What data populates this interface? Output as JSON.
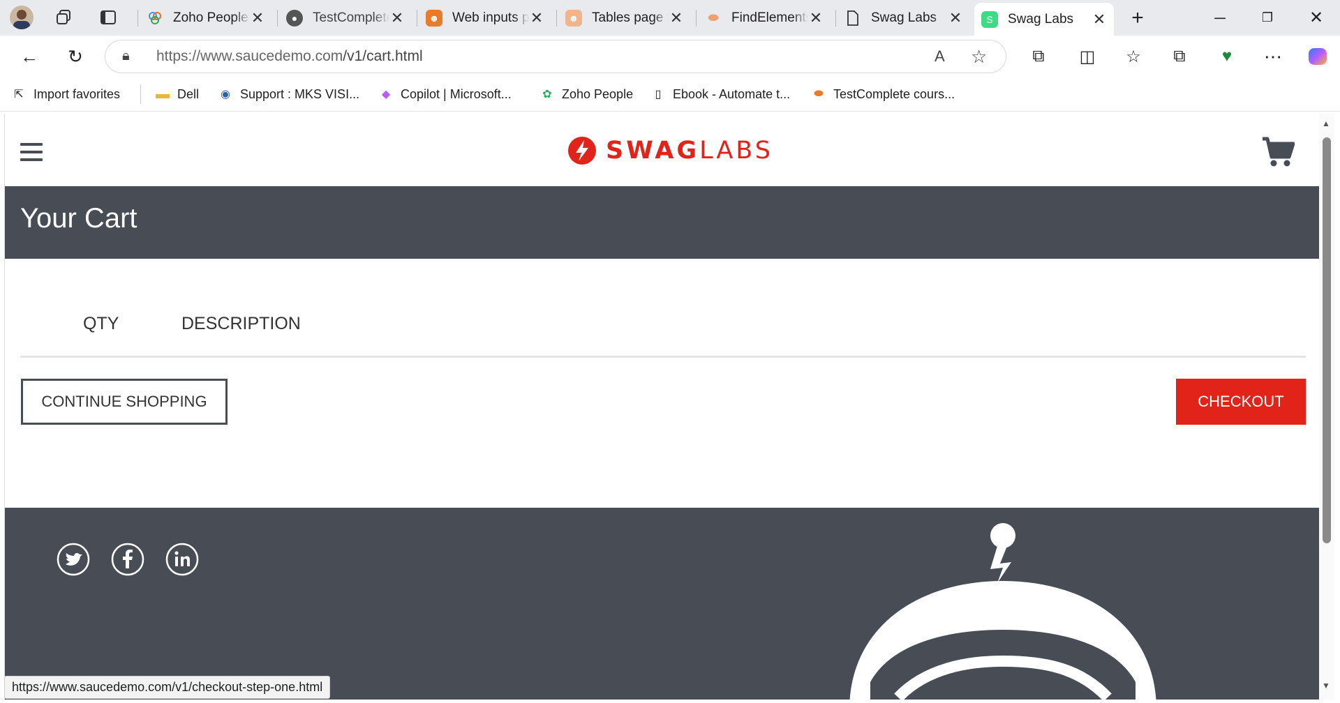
{
  "browser": {
    "tabs": [
      {
        "title": "Zoho People",
        "icon": "zoho-icon"
      },
      {
        "title": "TestComplete",
        "icon": "github-icon"
      },
      {
        "title": "Web inputs page",
        "icon": "robot-icon"
      },
      {
        "title": "Tables page for",
        "icon": "robot-icon"
      },
      {
        "title": "FindElements",
        "icon": "controller-icon"
      },
      {
        "title": "Swag Labs",
        "icon": "page-icon"
      },
      {
        "title": "Swag Labs",
        "icon": "swag-icon",
        "active": true
      }
    ],
    "url_host": "https://www.saucedemo.com",
    "url_path": "/v1/cart.html",
    "bookmarks": [
      {
        "label": "Import favorites",
        "icon": "import-icon"
      },
      {
        "label": "Dell",
        "icon": "folder-icon"
      },
      {
        "label": "Support : MKS VISI...",
        "icon": "globe-icon"
      },
      {
        "label": "Copilot | Microsoft...",
        "icon": "copilot-icon"
      },
      {
        "label": "Zoho People",
        "icon": "zoho-icon"
      },
      {
        "label": "Ebook - Automate t...",
        "icon": "page-icon"
      },
      {
        "label": "TestComplete cours...",
        "icon": "controller-icon"
      }
    ],
    "status_url": "https://www.saucedemo.com/v1/checkout-step-one.html"
  },
  "app": {
    "logo_bold": "SWAG",
    "logo_light": "LABS",
    "page_title": "Your Cart",
    "columns": {
      "qty": "QTY",
      "description": "DESCRIPTION"
    },
    "buttons": {
      "continue": "CONTINUE SHOPPING",
      "checkout": "CHECKOUT"
    },
    "social": [
      "twitter-icon",
      "facebook-icon",
      "linkedin-icon"
    ]
  },
  "colors": {
    "brand_red": "#e2231a",
    "header_dark": "#474c55"
  }
}
